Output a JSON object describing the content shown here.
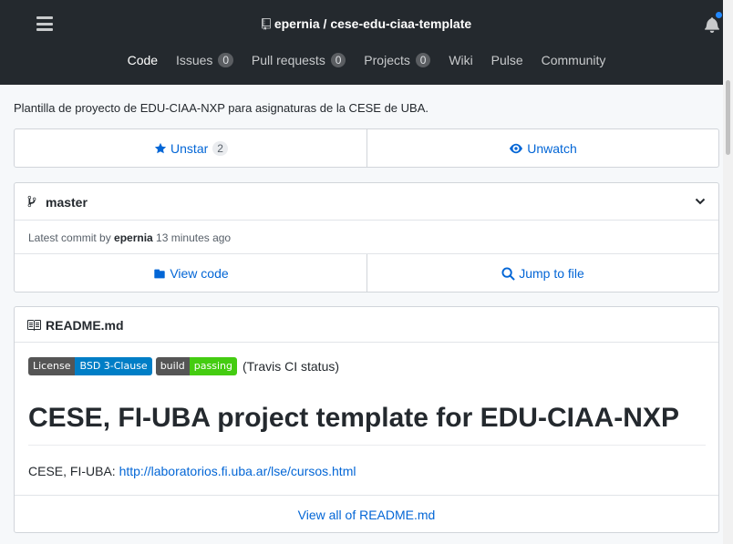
{
  "header": {
    "owner": "epernia",
    "separator": " / ",
    "repo": "cese-edu-ciaa-template",
    "nav": [
      {
        "label": "Code",
        "count": null
      },
      {
        "label": "Issues",
        "count": "0"
      },
      {
        "label": "Pull requests",
        "count": "0"
      },
      {
        "label": "Projects",
        "count": "0"
      },
      {
        "label": "Wiki",
        "count": null
      },
      {
        "label": "Pulse",
        "count": null
      },
      {
        "label": "Community",
        "count": null
      }
    ]
  },
  "description": "Plantilla de proyecto de EDU-CIAA-NXP para asignaturas de la CESE de UBA.",
  "actions": {
    "unstar_label": "Unstar",
    "star_count": "2",
    "unwatch_label": "Unwatch"
  },
  "branch": {
    "name": "master",
    "commit_prefix": "Latest commit by ",
    "commit_author": "epernia",
    "commit_time": " 13 minutes ago",
    "view_code": "View code",
    "jump_to_file": "Jump to file"
  },
  "readme": {
    "filename": "README.md",
    "badges": [
      {
        "left": "License",
        "right": "BSD 3-Clause",
        "right_color": "#007ec6"
      },
      {
        "left": "build",
        "right": "passing",
        "right_color": "#44cc11"
      }
    ],
    "travis_text": "(Travis CI status)",
    "heading": "CESE, FI-UBA project template for EDU-CIAA-NXP",
    "link_prefix": "CESE, FI-UBA: ",
    "link_text": "http://laboratorios.fi.uba.ar/lse/cursos.html",
    "view_all": "View all of README.md"
  },
  "colors": {
    "header_bg": "#24292e",
    "link": "#0366d6",
    "notification_dot": "#2188ff"
  },
  "icons": [
    "menu-icon",
    "repo-icon",
    "bell-icon",
    "star-icon",
    "eye-icon",
    "branch-icon",
    "chevron-down-icon",
    "folder-icon",
    "search-icon",
    "book-icon"
  ]
}
